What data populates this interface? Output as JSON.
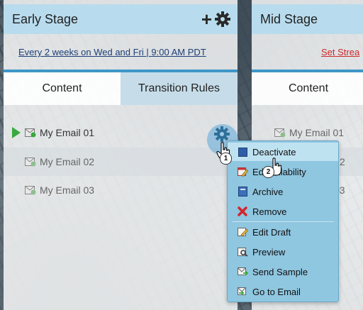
{
  "early_stage": {
    "title": "Early Stage",
    "plus_icon": "+",
    "schedule": "Every 2 weeks on Wed and Fri | 9:00 AM PDT",
    "tabs": [
      "Content",
      "Transition Rules"
    ],
    "emails": [
      "My Email 01",
      "My Email 02",
      "My Email 03"
    ]
  },
  "mid_stage": {
    "title": "Mid Stage",
    "schedule": "Set Strea",
    "tabs": [
      "Content"
    ],
    "emails": [
      "My Email 01",
      "2",
      "03"
    ]
  },
  "menu": {
    "items": [
      "Deactivate",
      "Edit Availability",
      "Archive",
      "Remove",
      "Edit Draft",
      "Preview",
      "Send Sample",
      "Go to Email"
    ],
    "item2_parts": [
      "Edi",
      "ilability"
    ]
  },
  "cursors": {
    "badge1": "1",
    "badge2": "2"
  },
  "colors": {
    "header": "#b8dcee",
    "tab_accent": "#3f96c8",
    "menu_bg": "#8fc6e0",
    "active": "#bfe2f1",
    "remove": "#d4252b",
    "play": "#3aa93f"
  }
}
